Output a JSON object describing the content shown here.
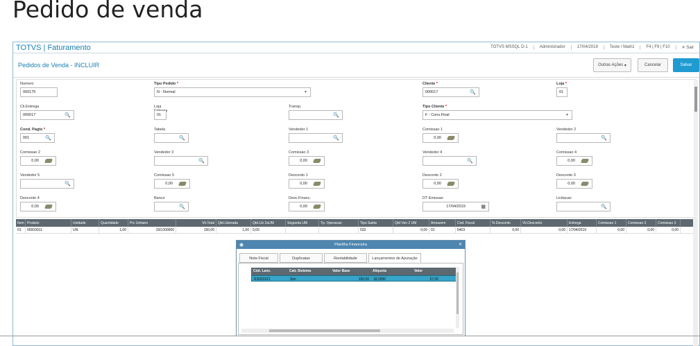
{
  "slide_title": "Pedido de venda",
  "app": {
    "title": "TOTVS | Faturamento"
  },
  "status": [
    "TOTVS MSSQL D-1",
    "Administrador",
    "17/04/2019",
    "Teste / Matriz",
    "F4 | F9 | F10",
    "✕ Sair"
  ],
  "page": {
    "title": "Pedidos de Venda - INCLUIR",
    "buttons": {
      "more": "Outras Ações",
      "cancel": "Cancelar",
      "save": "Salvar"
    }
  },
  "fields": {
    "numero": {
      "label": "Numero",
      "value": "000175"
    },
    "tipo_pedido": {
      "label": "Tipo Pedido",
      "value": "N - Normal"
    },
    "cliente": {
      "label": "Cliente",
      "value": "000017"
    },
    "loja": {
      "label": "Loja",
      "value": "01"
    },
    "cli_entrega": {
      "label": "Cli.Entrega",
      "value": "000017"
    },
    "loja_entrega": {
      "label": "Loja Entrega",
      "value": "01"
    },
    "transp": {
      "label": "Transp.",
      "value": ""
    },
    "tipo_cliente": {
      "label": "Tipo Cliente",
      "value": "F - Cons.Final"
    },
    "cond_pagto": {
      "label": "Cond. Pagto",
      "value": "001"
    },
    "tabela": {
      "label": "Tabela",
      "value": ""
    },
    "vendedor1": {
      "label": "Vendedor 1",
      "value": ""
    },
    "comissao1": {
      "label": "Comissao 1",
      "value": "0,00"
    },
    "vendedor2": {
      "label": "Vendedor 2",
      "value": ""
    },
    "comissao2": {
      "label": "Comissao 2",
      "value": "0,00"
    },
    "vendedor3": {
      "label": "Vendedor 3",
      "value": ""
    },
    "comissao3": {
      "label": "Comissao 3",
      "value": "0,00"
    },
    "vendedor4": {
      "label": "Vendedor 4",
      "value": ""
    },
    "comissao4": {
      "label": "Comissao 4",
      "value": "0,00"
    },
    "vendedor5": {
      "label": "Vendedor 5",
      "value": ""
    },
    "comissao5": {
      "label": "Comissao 5",
      "value": "0,00"
    },
    "desconto1": {
      "label": "Desconto 1",
      "value": "0,00"
    },
    "desconto2": {
      "label": "Desconto 2",
      "value": "0,00"
    },
    "desconto3": {
      "label": "Desconto 3",
      "value": "0,00"
    },
    "desconto4": {
      "label": "Desconto 4",
      "value": "0,00"
    },
    "banco": {
      "label": "Banco",
      "value": ""
    },
    "desc_financ": {
      "label": "Desc.Financ.",
      "value": "0,00"
    },
    "dt_emissao": {
      "label": "DT Emissao",
      "value": "17/04/2019"
    },
    "licitacao": {
      "label": "Licitacao",
      "value": ""
    }
  },
  "grid": {
    "headers": [
      "Item",
      "Produto",
      "Unidade",
      "Quantidade",
      "Prc Unitario",
      "Vlr.Total",
      "Qtd.Liberada",
      "Qtd.Lib 2aUM",
      "Segunda UM",
      "Tp. Operacao",
      "Tipo Saida",
      "Qtd Ven 2 UM",
      "Armazem",
      "Cod. Fiscal",
      "% Desconto",
      "Vlr.Desconto",
      "Entrega",
      "Comissao 1",
      "Comissao 2",
      "Comissao 3"
    ],
    "row": [
      "01",
      "00003011",
      "UN",
      "1,00",
      "150,000000",
      "150,00",
      "1,00",
      "0,00",
      "",
      "",
      "533",
      "0,00",
      "01",
      "5403",
      "0,00",
      "0,00",
      "17/04/2019",
      "0,00",
      "0,00",
      "0,00"
    ]
  },
  "dialog": {
    "title": "Planilha Financeira",
    "tabs": [
      "Nota Fiscal",
      "Duplicatas",
      "Rentabilidade",
      "Lançamentos de Apuração"
    ],
    "headers": [
      "Cód. Lanc.",
      "Calc Sistema",
      "Valor Base",
      "Aliquota",
      "Valor"
    ],
    "row": [
      "RS001921",
      "Sim",
      "150,00",
      "18,0000",
      "27,00"
    ]
  }
}
